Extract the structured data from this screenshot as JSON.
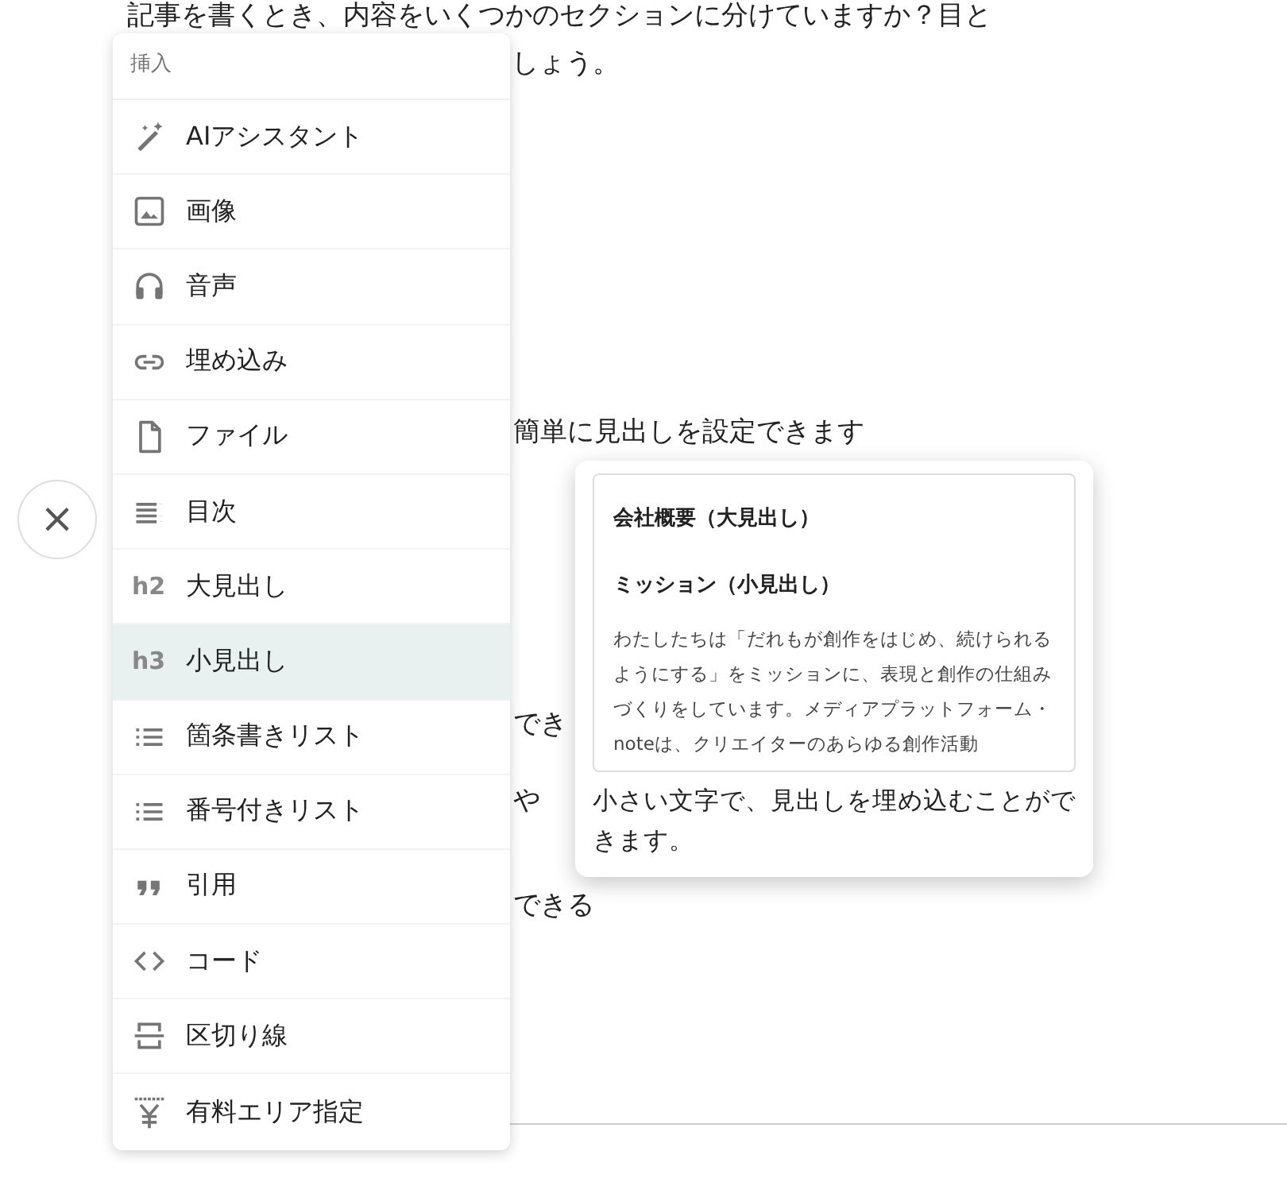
{
  "background_text": [
    {
      "text": "記事を書くとき、内容をいくつかのセクションに分けていますか？目と"
    },
    {
      "text": "しょう。"
    },
    {
      "text": "簡単に見出しを設定できます"
    },
    {
      "text": "でき"
    },
    {
      "text": "や"
    },
    {
      "text": "できる"
    }
  ],
  "close_button": {
    "label": "×"
  },
  "insert_menu": {
    "heading": "挿入",
    "items": [
      {
        "kind": "ai",
        "label": "AIアシスタント",
        "selected": false
      },
      {
        "kind": "image",
        "label": "画像",
        "selected": false
      },
      {
        "kind": "audio",
        "label": "音声",
        "selected": false
      },
      {
        "kind": "embed",
        "label": "埋め込み",
        "selected": false
      },
      {
        "kind": "file",
        "label": "ファイル",
        "selected": false
      },
      {
        "kind": "toc",
        "label": "目次",
        "selected": false
      },
      {
        "kind": "heading",
        "tag": "h2",
        "label": "大見出し",
        "selected": false
      },
      {
        "kind": "heading",
        "tag": "h3",
        "label": "小見出し",
        "selected": true
      },
      {
        "kind": "list",
        "label": "箇条書きリスト",
        "selected": false
      },
      {
        "kind": "list",
        "label": "番号付きリスト",
        "selected": false
      },
      {
        "kind": "quote",
        "label": "引用",
        "selected": false
      },
      {
        "kind": "code",
        "label": "コード",
        "selected": false
      },
      {
        "kind": "divider",
        "label": "区切り線",
        "selected": false
      },
      {
        "kind": "paid",
        "label": "有料エリア指定",
        "selected": false
      }
    ]
  },
  "preview_popup": {
    "preview": {
      "heading": "会社概要（大見出し）",
      "subheading": "ミッション（小見出し）",
      "body": "わたしたちは「だれもが創作をはじめ、続けられるようにする」をミッションに、表現と創作の仕組みづくりをしています。メディアプラットフォーム・noteは、クリエイターのあらゆる創作活動"
    },
    "caption": "小さい文字で、見出しを埋め込むことができます。"
  }
}
